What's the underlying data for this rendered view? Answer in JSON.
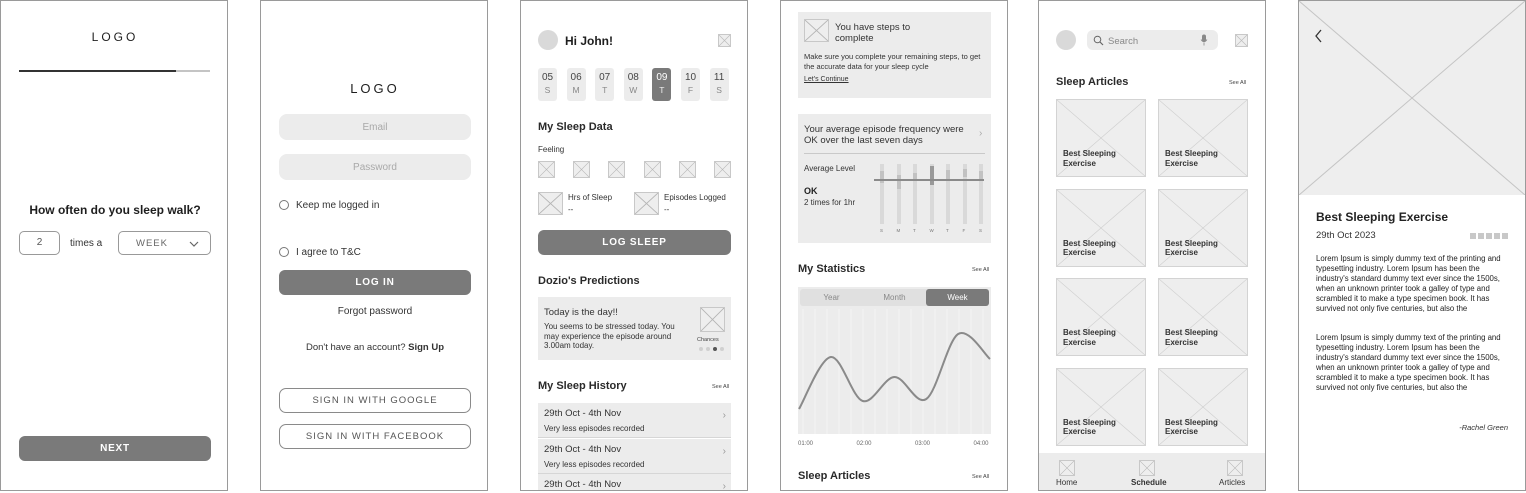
{
  "screen1": {
    "logo": "LOGO",
    "question": "How often do you sleep walk?",
    "count_value": "2",
    "times_label": "times a",
    "period_value": "WEEK",
    "next_label": "NEXT",
    "progress": 0.82
  },
  "screen2": {
    "logo": "LOGO",
    "email_placeholder": "Email",
    "password_placeholder": "Password",
    "keep_logged": "Keep me logged in",
    "agree_tc": "I agree to T&C",
    "login_label": "LOG IN",
    "forgot": "Forgot password",
    "no_account": "Don't have an account?",
    "signup": "Sign Up",
    "google_label": "SIGN IN WITH GOOGLE",
    "facebook_label": "SIGN IN WITH FACEBOOK"
  },
  "screen3": {
    "greeting": "Hi John!",
    "dates": [
      {
        "day": "05",
        "weekday": "S"
      },
      {
        "day": "06",
        "weekday": "M"
      },
      {
        "day": "07",
        "weekday": "T"
      },
      {
        "day": "08",
        "weekday": "W"
      },
      {
        "day": "09",
        "weekday": "T"
      },
      {
        "day": "10",
        "weekday": "F"
      },
      {
        "day": "11",
        "weekday": "S"
      }
    ],
    "selected_date_index": 4,
    "sleep_data_title": "My Sleep Data",
    "feeling_label": "Feeling",
    "hrs_label": "Hrs of Sleep",
    "hrs_value": "--",
    "episodes_label": "Episodes Logged",
    "episodes_value": "--",
    "log_sleep_label": "LOG SLEEP",
    "predictions_title": "Dozio's Predictions",
    "prediction_heading": "Today is the day!!",
    "prediction_body": "You seems to be stressed today. You may experience the episode around 3.00am today.",
    "chances_label": "Chances",
    "history_title": "My Sleep History",
    "history_see_all": "See All",
    "history": [
      {
        "range": "29th Oct - 4th Nov",
        "note": "Very less episodes recorded"
      },
      {
        "range": "29th Oct - 4th Nov",
        "note": "Very less episodes recorded"
      },
      {
        "range": "29th Oct - 4th Nov",
        "note": ""
      }
    ]
  },
  "screen4": {
    "steps_title": "You have steps to complete",
    "steps_body": "Make sure you complete your remaining steps, to get the accurate data for your sleep cycle",
    "steps_link": "Let's Continue",
    "freq_text": "Your average episode frequency were OK over the last seven days",
    "avg_level_label": "Average Level",
    "avg_status": "OK",
    "avg_detail": "2 times for 1hr",
    "mini_days": [
      "S",
      "M",
      "T",
      "W",
      "T",
      "F",
      "S"
    ],
    "stats_title": "My Statistics",
    "stats_see_all": "See All",
    "tabs": [
      "Year",
      "Month",
      "Week"
    ],
    "active_tab": "Week",
    "articles_title": "Sleep Articles",
    "articles_see_all": "See All"
  },
  "chart_data": {
    "type": "line",
    "x": [
      "01:00",
      "02:00",
      "03:00",
      "04:00"
    ],
    "xlabel": "",
    "ylabel": "",
    "grid": true,
    "series": [
      {
        "values": [
          0.1,
          0.62,
          0.18,
          0.42,
          0.2,
          0.85,
          0.6
        ]
      }
    ]
  },
  "screen5": {
    "search_placeholder": "Search",
    "articles_title": "Sleep Articles",
    "see_all": "See All",
    "articles": [
      "Best Sleeping Exercise",
      "Best Sleeping Exercise",
      "Best Sleeping Exercise",
      "Best Sleeping Exercise",
      "Best Sleeping Exercise",
      "Best Sleeping Exercise",
      "Best Sleeping Exercise",
      "Best Sleeping Exercise"
    ],
    "nav": [
      "Home",
      "Schedule",
      "Articles"
    ],
    "active_nav": "Schedule"
  },
  "screen6": {
    "title": "Best Sleeping Exercise",
    "date": "29th Oct 2023",
    "para1": "Lorem Ipsum is simply dummy text of the printing and typesetting industry. Lorem Ipsum has been the industry's standard dummy text ever since the 1500s, when an unknown printer took a galley of type and scrambled it to make a type specimen book. It has survived not only five centuries, but also the",
    "para2": "Lorem Ipsum is simply dummy text of the printing and typesetting industry. Lorem Ipsum has been the industry's standard dummy text ever since the 1500s, when an unknown printer took a galley of type and scrambled it to make a type specimen book. It has survived not only five centuries, but also the",
    "author": "-Rachel Green"
  }
}
